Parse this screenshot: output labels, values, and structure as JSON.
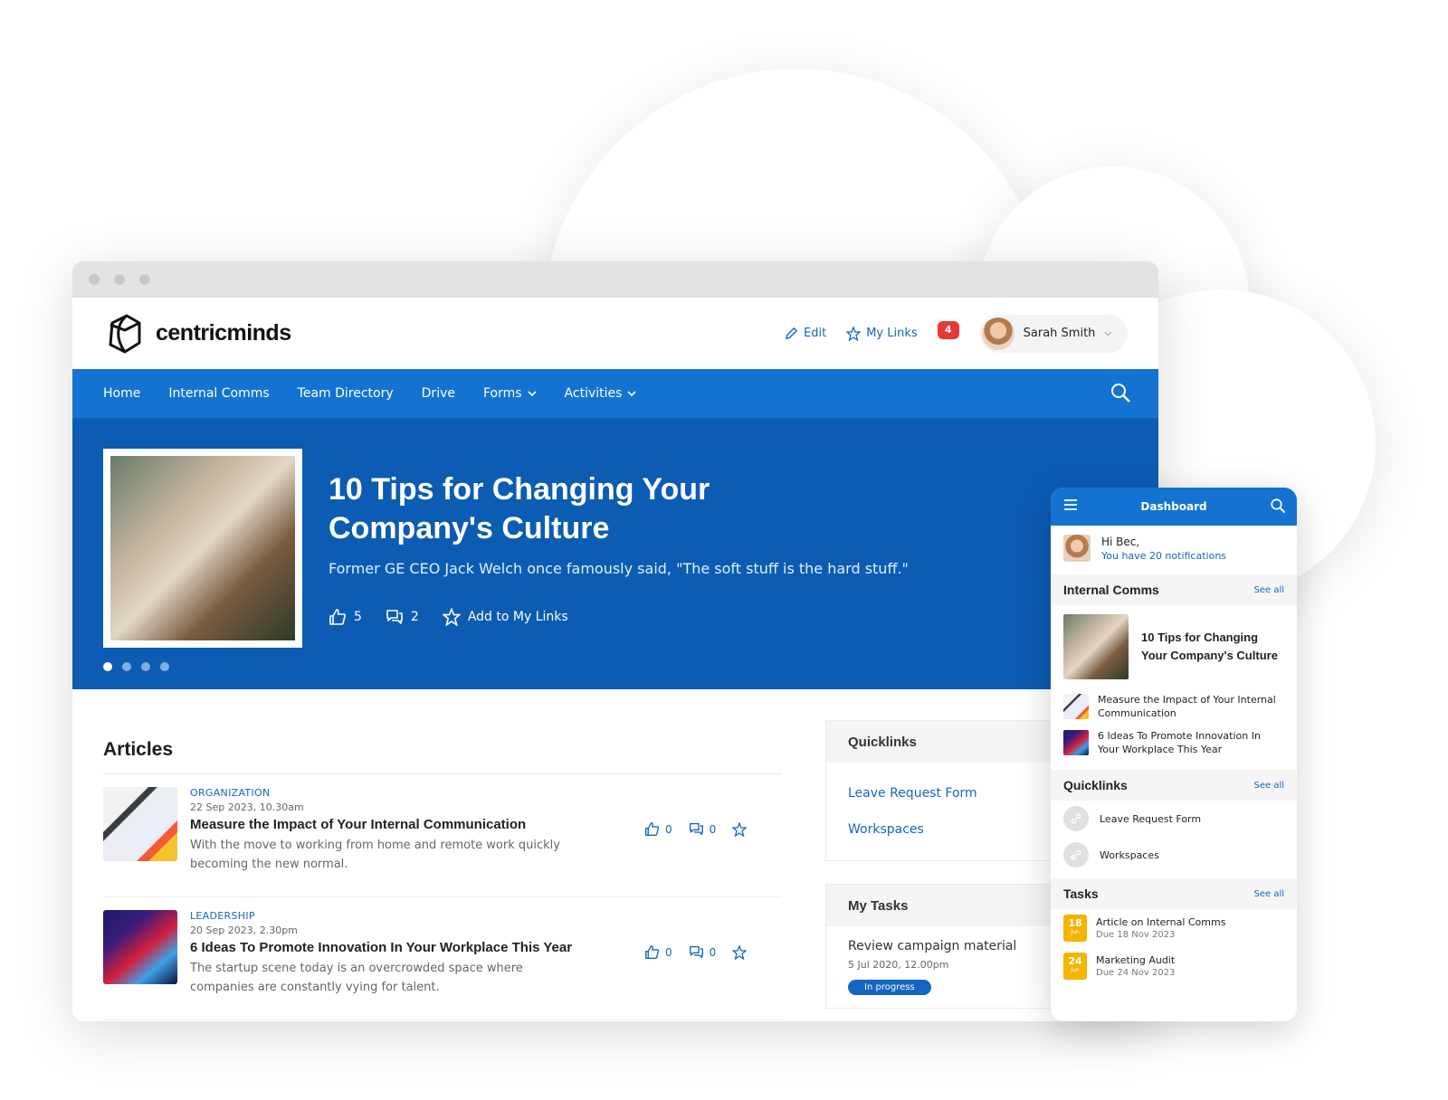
{
  "brand": {
    "name": "centricminds"
  },
  "header": {
    "edit_label": "Edit",
    "mylinks_label": "My Links",
    "notification_count": "4",
    "user_name": "Sarah Smith"
  },
  "nav": {
    "items": [
      {
        "label": "Home"
      },
      {
        "label": "Internal Comms"
      },
      {
        "label": "Team Directory"
      },
      {
        "label": "Drive"
      },
      {
        "label": "Forms"
      },
      {
        "label": "Activities"
      }
    ]
  },
  "hero": {
    "title": "10 Tips for Changing Your Company's Culture",
    "subtitle": "Former GE CEO Jack Welch once famously said, \"The soft stuff is the hard stuff.\"",
    "likes": "5",
    "comments": "2",
    "add_label": "Add to My Links"
  },
  "articles": {
    "heading": "Articles",
    "items": [
      {
        "category": "ORGANIZATION",
        "date": "22 Sep 2023, 10.30am",
        "title": "Measure the Impact of Your Internal Communication",
        "desc": "With the move to working from home and remote work quickly becoming the new normal.",
        "likes": "0",
        "comments": "0"
      },
      {
        "category": "LEADERSHIP",
        "date": "20 Sep 2023, 2.30pm",
        "title": "6 Ideas To Promote Innovation In Your Workplace This Year",
        "desc": "The startup scene today is an overcrowded space where companies are constantly vying for talent.",
        "likes": "0",
        "comments": "0"
      }
    ]
  },
  "quicklinks": {
    "heading": "Quicklinks",
    "items": [
      "Leave Request Form",
      "Workspaces"
    ]
  },
  "mytasks": {
    "heading": "My Tasks",
    "task": "Review campaign material",
    "date": "5 Jul 2020, 12.00pm",
    "status": "In progress"
  },
  "mobile": {
    "title": "Dashboard",
    "greeting": "Hi Bec,",
    "notifications": "You have 20 notifications",
    "see_all": "See all",
    "comms_heading": "Internal Comms",
    "featured": "10 Tips for Changing Your Company's Culture",
    "comms_items": [
      "Measure the Impact of Your Internal Communication",
      "6 Ideas To Promote Innovation In Your Workplace This Year"
    ],
    "quick_heading": "Quicklinks",
    "quick_items": [
      "Leave Request Form",
      "Workspaces"
    ],
    "tasks_heading": "Tasks",
    "tasks": [
      {
        "title": "Article on Internal Comms",
        "due": "Due 18 Nov 2023",
        "day": "18",
        "mon": "Jun"
      },
      {
        "title": "Marketing Audit",
        "due": "Due 24 Nov 2023",
        "day": "24",
        "mon": "Jun"
      }
    ]
  },
  "colors": {
    "primary": "#1473d1",
    "hero": "#0c5cb3",
    "accent": "#1565c0",
    "badge": "#e53935",
    "calendar": "#f4b400"
  }
}
